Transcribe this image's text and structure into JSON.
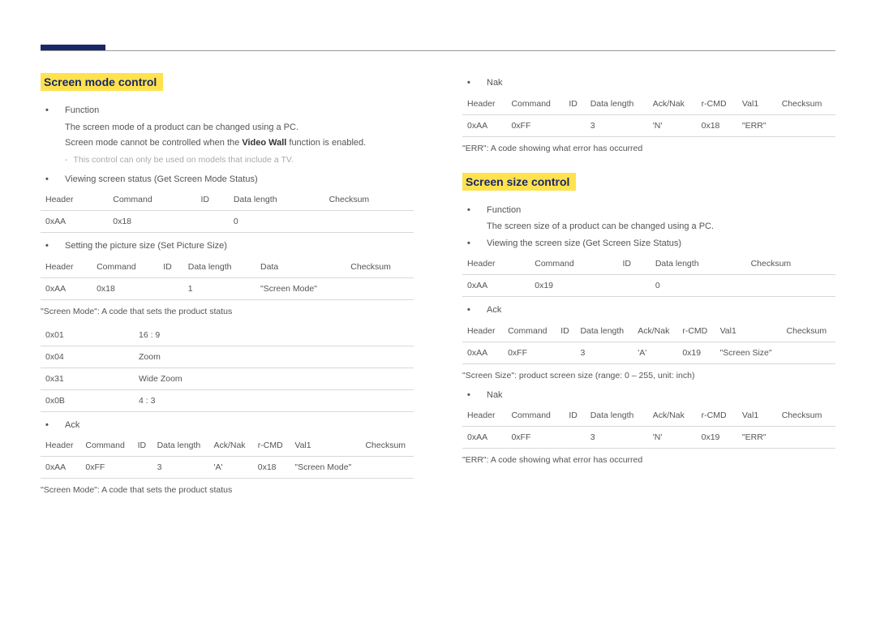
{
  "left": {
    "title": "Screen mode control",
    "bullet_function": "Function",
    "func_line1": "The screen mode of a product can be changed using a PC.",
    "func_line2_a": "Screen mode cannot be controlled when the ",
    "func_line2_b": "Video Wall",
    "func_line2_c": " function is enabled.",
    "note": "This control can only be used on models that include a TV.",
    "bullet_view": "Viewing screen status (Get Screen Mode Status)",
    "t1": {
      "h": [
        "Header",
        "Command",
        "ID",
        "Data length",
        "Checksum"
      ],
      "r": [
        "0xAA",
        "0x18",
        "",
        "0",
        ""
      ]
    },
    "bullet_set": "Setting the picture size (Set Picture Size)",
    "t2": {
      "h": [
        "Header",
        "Command",
        "ID",
        "Data length",
        "Data",
        "Checksum"
      ],
      "r": [
        "0xAA",
        "0x18",
        "",
        "1",
        "\"Screen Mode\"",
        ""
      ]
    },
    "desc_modes": "\"Screen Mode\": A code that sets the product status",
    "t3": {
      "rows": [
        [
          "0x01",
          "16 : 9"
        ],
        [
          "0x04",
          "Zoom"
        ],
        [
          "0x31",
          "Wide Zoom"
        ],
        [
          "0x0B",
          "4 : 3"
        ]
      ]
    },
    "bullet_ack": "Ack",
    "t4": {
      "h": [
        "Header",
        "Command",
        "ID",
        "Data length",
        "Ack/Nak",
        "r-CMD",
        "Val1",
        "Checksum"
      ],
      "r": [
        "0xAA",
        "0xFF",
        "",
        "3",
        "'A'",
        "0x18",
        "\"Screen Mode\"",
        ""
      ]
    },
    "desc_ack": "\"Screen Mode\": A code that sets the product status"
  },
  "right": {
    "bullet_nak_top": "Nak",
    "t5": {
      "h": [
        "Header",
        "Command",
        "ID",
        "Data length",
        "Ack/Nak",
        "r-CMD",
        "Val1",
        "Checksum"
      ],
      "r": [
        "0xAA",
        "0xFF",
        "",
        "3",
        "'N'",
        "0x18",
        "\"ERR\"",
        ""
      ]
    },
    "desc_err_top": "\"ERR\": A code showing what error has occurred",
    "title": "Screen size control",
    "bullet_function": "Function",
    "func_line1": "The screen size of a product can be changed using a PC.",
    "bullet_view": "Viewing the screen size (Get Screen Size Status)",
    "t6": {
      "h": [
        "Header",
        "Command",
        "ID",
        "Data length",
        "Checksum"
      ],
      "r": [
        "0xAA",
        "0x19",
        "",
        "0",
        ""
      ]
    },
    "bullet_ack": "Ack",
    "t7": {
      "h": [
        "Header",
        "Command",
        "ID",
        "Data length",
        "Ack/Nak",
        "r-CMD",
        "Val1",
        "Checksum"
      ],
      "r": [
        "0xAA",
        "0xFF",
        "",
        "3",
        "'A'",
        "0x19",
        "\"Screen Size\"",
        ""
      ]
    },
    "desc_size": "\"Screen Size\": product screen size (range: 0 – 255, unit: inch)",
    "bullet_nak": "Nak",
    "t8": {
      "h": [
        "Header",
        "Command",
        "ID",
        "Data length",
        "Ack/Nak",
        "r-CMD",
        "Val1",
        "Checksum"
      ],
      "r": [
        "0xAA",
        "0xFF",
        "",
        "3",
        "'N'",
        "0x19",
        "\"ERR\"",
        ""
      ]
    },
    "desc_err": "\"ERR\": A code showing what error has occurred"
  },
  "ht": "•"
}
